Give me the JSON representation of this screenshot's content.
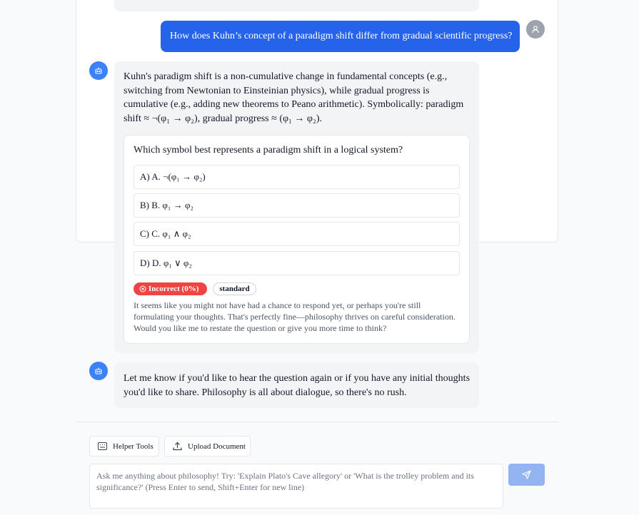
{
  "user_message": "How does Kuhn’s concept of a paradigm shift differ from gradual scientific progress?",
  "bot_response": {
    "text": "Kuhn's paradigm shift is a non-cumulative change in fundamental concepts (e.g., switching from Newtonian to Einsteinian physics), while gradual progress is cumulative (e.g., adding new theorems to Peano arithmetic). Symbolically: paradigm shift ≈ ¬(φ₁ → φ₂), gradual progress ≈ (φ₁ → φ₂)."
  },
  "quiz": {
    "question": "Which symbol best represents a paradigm shift in a logical system?",
    "options": [
      "A) A. ¬(φ₁ → φ₂)",
      "B) B. φ₁ → φ₂",
      "C) C. φ₁ ∧ φ₂",
      "D) D. φ₁ ∨ φ₂"
    ],
    "result_badge": "Incorrect (0%)",
    "level_badge": "standard",
    "feedback": "It seems like you might not have had a chance to respond yet, or perhaps you're still formulating your thoughts. That's perfectly fine—philosophy thrives on careful consideration. Would you like me to restate the question or give you more time to think?"
  },
  "followup_message": "Let me know if you'd like to hear the question again or if you have any initial thoughts you'd like to share. Philosophy is all about dialogue, so there's no rush.",
  "toolbar": {
    "helper_tools_label": "Helper Tools",
    "upload_label": "Upload Document"
  },
  "input": {
    "placeholder": "Ask me anything about philosophy! Try: 'Explain Plato's Cave allegory' or 'What is the trolley problem and its significance?' (Press Enter to send, Shift+Enter for new line)",
    "value": ""
  },
  "colors": {
    "user_bubble": "#2563eb",
    "bot_avatar": "#3b82f6",
    "incorrect_badge": "#ef4444",
    "send_button": "#93b4f0"
  },
  "icons": {
    "user_avatar": "user-icon",
    "bot_avatar": "robot-icon",
    "helper_tools": "keyboard-icon",
    "upload": "upload-icon",
    "send": "send-icon",
    "incorrect": "x-circle-icon"
  }
}
